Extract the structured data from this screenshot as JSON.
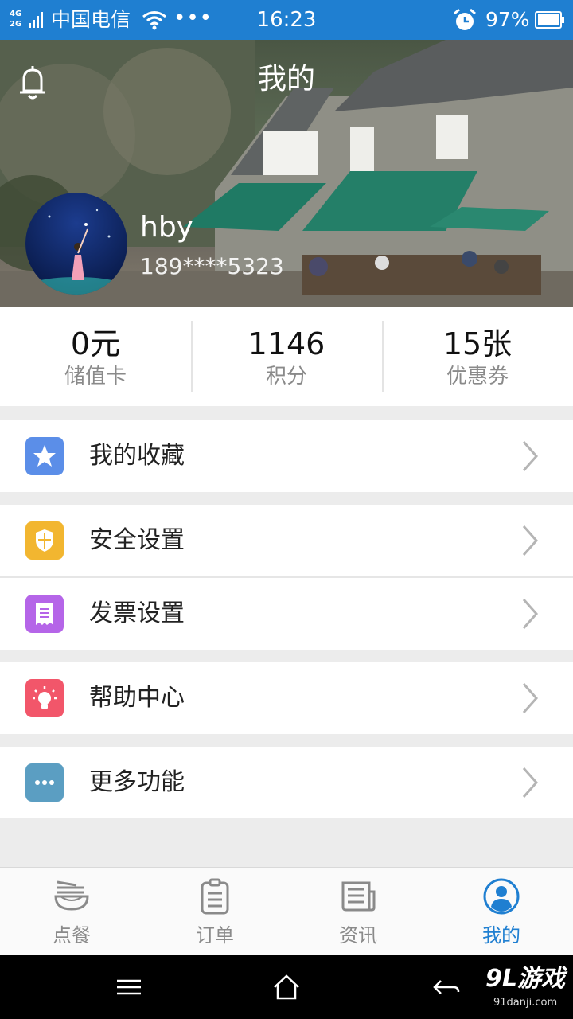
{
  "status_bar": {
    "network_top": "4G",
    "network_bottom": "2G",
    "carrier": "中国电信",
    "more": "•••",
    "time": "16:23",
    "battery": "97%",
    "icons": [
      "signal-icon",
      "wifi-icon",
      "alarm-icon",
      "battery-icon"
    ]
  },
  "header": {
    "title": "我的",
    "username": "hby",
    "phone": "189****5323",
    "icons": [
      "bell-icon",
      "avatar"
    ]
  },
  "stats": [
    {
      "value": "0元",
      "label": "储值卡"
    },
    {
      "value": "1146",
      "label": "积分"
    },
    {
      "value": "15张",
      "label": "优惠券"
    }
  ],
  "menu": [
    {
      "label": "我的收藏",
      "icon": "star-icon",
      "color": "#5b8ee8"
    },
    {
      "label": "安全设置",
      "icon": "shield-icon",
      "color": "#f2b630"
    },
    {
      "label": "发票设置",
      "icon": "receipt-icon",
      "color": "#b565e8"
    },
    {
      "label": "帮助中心",
      "icon": "lightbulb-icon",
      "color": "#f2566a"
    },
    {
      "label": "更多功能",
      "icon": "more-icon",
      "color": "#5b9ec2"
    }
  ],
  "tabs": [
    {
      "label": "点餐",
      "icon": "noodle-bowl-icon",
      "active": false
    },
    {
      "label": "订单",
      "icon": "clipboard-icon",
      "active": false
    },
    {
      "label": "资讯",
      "icon": "newspaper-icon",
      "active": false
    },
    {
      "label": "我的",
      "icon": "user-icon",
      "active": true
    }
  ],
  "colors": {
    "accent": "#1f7fd1",
    "background": "#ececec",
    "text_primary": "#222222",
    "text_secondary": "#8a8a8a"
  },
  "watermark": {
    "brand": "9L游戏",
    "site": "91danji.com"
  },
  "navigation_bar": [
    "menu-icon",
    "home-icon",
    "back-icon"
  ]
}
